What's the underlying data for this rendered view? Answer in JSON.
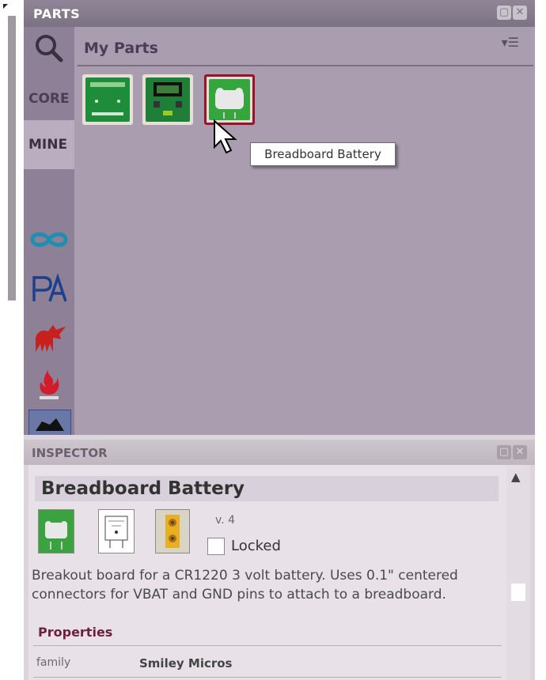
{
  "parts_panel": {
    "title": "PARTS",
    "bin_tabs": [
      "CORE",
      "MINE"
    ],
    "bin_title": "My Parts",
    "parts": [
      {
        "name": "breakout-part-1"
      },
      {
        "name": "lcd-part"
      },
      {
        "name": "Breadboard Battery"
      }
    ],
    "tooltip": "Breadboard Battery"
  },
  "inspector": {
    "title": "INSPECTOR",
    "part_name": "Breadboard Battery",
    "version": "v. 4",
    "locked_label": "Locked",
    "locked_checked": false,
    "description": "Breakout board for a CR1220 3 volt battery. Uses 0.1\" centered connectors for VBAT and GND pins to attach to a breadboard.",
    "properties_title": "Properties",
    "properties": [
      {
        "key": "family",
        "value": "Smiley Micros"
      }
    ]
  },
  "icons": {
    "search": "search-icon",
    "menu": "menu-icon",
    "float": "float-icon",
    "close": "close-icon",
    "arduino": "arduino-icon",
    "pa": "pa-icon",
    "sparkfun": "sparkfun-icon",
    "fire": "fire-icon",
    "truck": "bin-icon"
  },
  "colors": {
    "panel_bg": "#aa9db0",
    "title_bar": "#8a8090",
    "selected_border": "#a10f2b",
    "pcb_green": "#1d8a3a"
  }
}
